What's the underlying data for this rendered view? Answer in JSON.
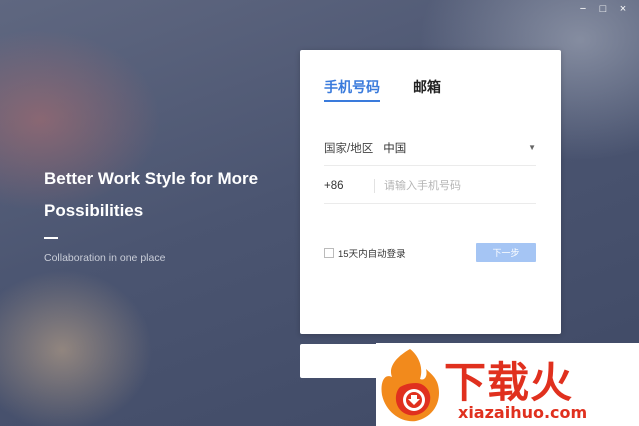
{
  "window": {
    "minimize_label": "−",
    "maximize_label": "□",
    "close_label": "×"
  },
  "hero": {
    "title": "Better Work Style for More Possibilities",
    "subtitle": "Collaboration in one place"
  },
  "login": {
    "tabs": [
      {
        "label": "手机号码",
        "active": true
      },
      {
        "label": "邮箱",
        "active": false
      }
    ],
    "region_label": "国家/地区",
    "region_value": "中国",
    "country_code": "+86",
    "phone_placeholder": "请输入手机号码",
    "remember_label": "15天内自动登录",
    "next_label": "下一步"
  },
  "watermark": {
    "cn_text": "下载火",
    "en_text": "xiazaihuo.com"
  },
  "colors": {
    "accent": "#3a7bdc",
    "next_button": "#a5c5f4",
    "watermark": "#e0301e"
  }
}
